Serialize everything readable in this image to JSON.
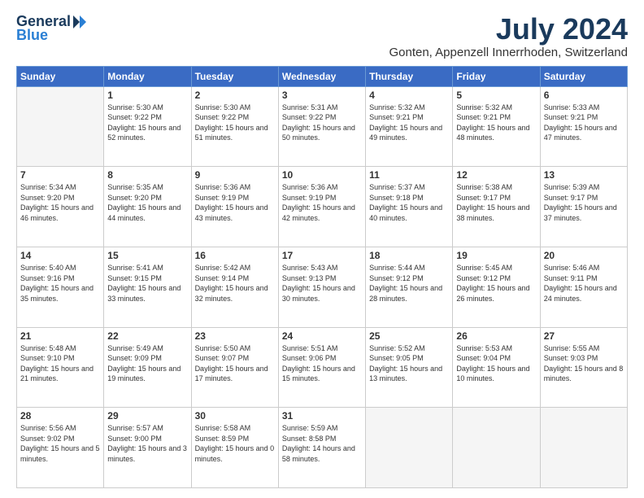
{
  "logo": {
    "general": "General",
    "blue": "Blue"
  },
  "header": {
    "month": "July 2024",
    "location": "Gonten, Appenzell Innerrhoden, Switzerland"
  },
  "weekdays": [
    "Sunday",
    "Monday",
    "Tuesday",
    "Wednesday",
    "Thursday",
    "Friday",
    "Saturday"
  ],
  "weeks": [
    [
      {
        "day": "",
        "empty": true
      },
      {
        "day": "1",
        "sunrise": "5:30 AM",
        "sunset": "9:22 PM",
        "daylight": "15 hours and 52 minutes."
      },
      {
        "day": "2",
        "sunrise": "5:30 AM",
        "sunset": "9:22 PM",
        "daylight": "15 hours and 51 minutes."
      },
      {
        "day": "3",
        "sunrise": "5:31 AM",
        "sunset": "9:22 PM",
        "daylight": "15 hours and 50 minutes."
      },
      {
        "day": "4",
        "sunrise": "5:32 AM",
        "sunset": "9:21 PM",
        "daylight": "15 hours and 49 minutes."
      },
      {
        "day": "5",
        "sunrise": "5:32 AM",
        "sunset": "9:21 PM",
        "daylight": "15 hours and 48 minutes."
      },
      {
        "day": "6",
        "sunrise": "5:33 AM",
        "sunset": "9:21 PM",
        "daylight": "15 hours and 47 minutes."
      }
    ],
    [
      {
        "day": "7",
        "sunrise": "5:34 AM",
        "sunset": "9:20 PM",
        "daylight": "15 hours and 46 minutes."
      },
      {
        "day": "8",
        "sunrise": "5:35 AM",
        "sunset": "9:20 PM",
        "daylight": "15 hours and 44 minutes."
      },
      {
        "day": "9",
        "sunrise": "5:36 AM",
        "sunset": "9:19 PM",
        "daylight": "15 hours and 43 minutes."
      },
      {
        "day": "10",
        "sunrise": "5:36 AM",
        "sunset": "9:19 PM",
        "daylight": "15 hours and 42 minutes."
      },
      {
        "day": "11",
        "sunrise": "5:37 AM",
        "sunset": "9:18 PM",
        "daylight": "15 hours and 40 minutes."
      },
      {
        "day": "12",
        "sunrise": "5:38 AM",
        "sunset": "9:17 PM",
        "daylight": "15 hours and 38 minutes."
      },
      {
        "day": "13",
        "sunrise": "5:39 AM",
        "sunset": "9:17 PM",
        "daylight": "15 hours and 37 minutes."
      }
    ],
    [
      {
        "day": "14",
        "sunrise": "5:40 AM",
        "sunset": "9:16 PM",
        "daylight": "15 hours and 35 minutes."
      },
      {
        "day": "15",
        "sunrise": "5:41 AM",
        "sunset": "9:15 PM",
        "daylight": "15 hours and 33 minutes."
      },
      {
        "day": "16",
        "sunrise": "5:42 AM",
        "sunset": "9:14 PM",
        "daylight": "15 hours and 32 minutes."
      },
      {
        "day": "17",
        "sunrise": "5:43 AM",
        "sunset": "9:13 PM",
        "daylight": "15 hours and 30 minutes."
      },
      {
        "day": "18",
        "sunrise": "5:44 AM",
        "sunset": "9:12 PM",
        "daylight": "15 hours and 28 minutes."
      },
      {
        "day": "19",
        "sunrise": "5:45 AM",
        "sunset": "9:12 PM",
        "daylight": "15 hours and 26 minutes."
      },
      {
        "day": "20",
        "sunrise": "5:46 AM",
        "sunset": "9:11 PM",
        "daylight": "15 hours and 24 minutes."
      }
    ],
    [
      {
        "day": "21",
        "sunrise": "5:48 AM",
        "sunset": "9:10 PM",
        "daylight": "15 hours and 21 minutes."
      },
      {
        "day": "22",
        "sunrise": "5:49 AM",
        "sunset": "9:09 PM",
        "daylight": "15 hours and 19 minutes."
      },
      {
        "day": "23",
        "sunrise": "5:50 AM",
        "sunset": "9:07 PM",
        "daylight": "15 hours and 17 minutes."
      },
      {
        "day": "24",
        "sunrise": "5:51 AM",
        "sunset": "9:06 PM",
        "daylight": "15 hours and 15 minutes."
      },
      {
        "day": "25",
        "sunrise": "5:52 AM",
        "sunset": "9:05 PM",
        "daylight": "15 hours and 13 minutes."
      },
      {
        "day": "26",
        "sunrise": "5:53 AM",
        "sunset": "9:04 PM",
        "daylight": "15 hours and 10 minutes."
      },
      {
        "day": "27",
        "sunrise": "5:55 AM",
        "sunset": "9:03 PM",
        "daylight": "15 hours and 8 minutes."
      }
    ],
    [
      {
        "day": "28",
        "sunrise": "5:56 AM",
        "sunset": "9:02 PM",
        "daylight": "15 hours and 5 minutes."
      },
      {
        "day": "29",
        "sunrise": "5:57 AM",
        "sunset": "9:00 PM",
        "daylight": "15 hours and 3 minutes."
      },
      {
        "day": "30",
        "sunrise": "5:58 AM",
        "sunset": "8:59 PM",
        "daylight": "15 hours and 0 minutes."
      },
      {
        "day": "31",
        "sunrise": "5:59 AM",
        "sunset": "8:58 PM",
        "daylight": "14 hours and 58 minutes."
      },
      {
        "day": "",
        "empty": true
      },
      {
        "day": "",
        "empty": true
      },
      {
        "day": "",
        "empty": true
      }
    ]
  ]
}
